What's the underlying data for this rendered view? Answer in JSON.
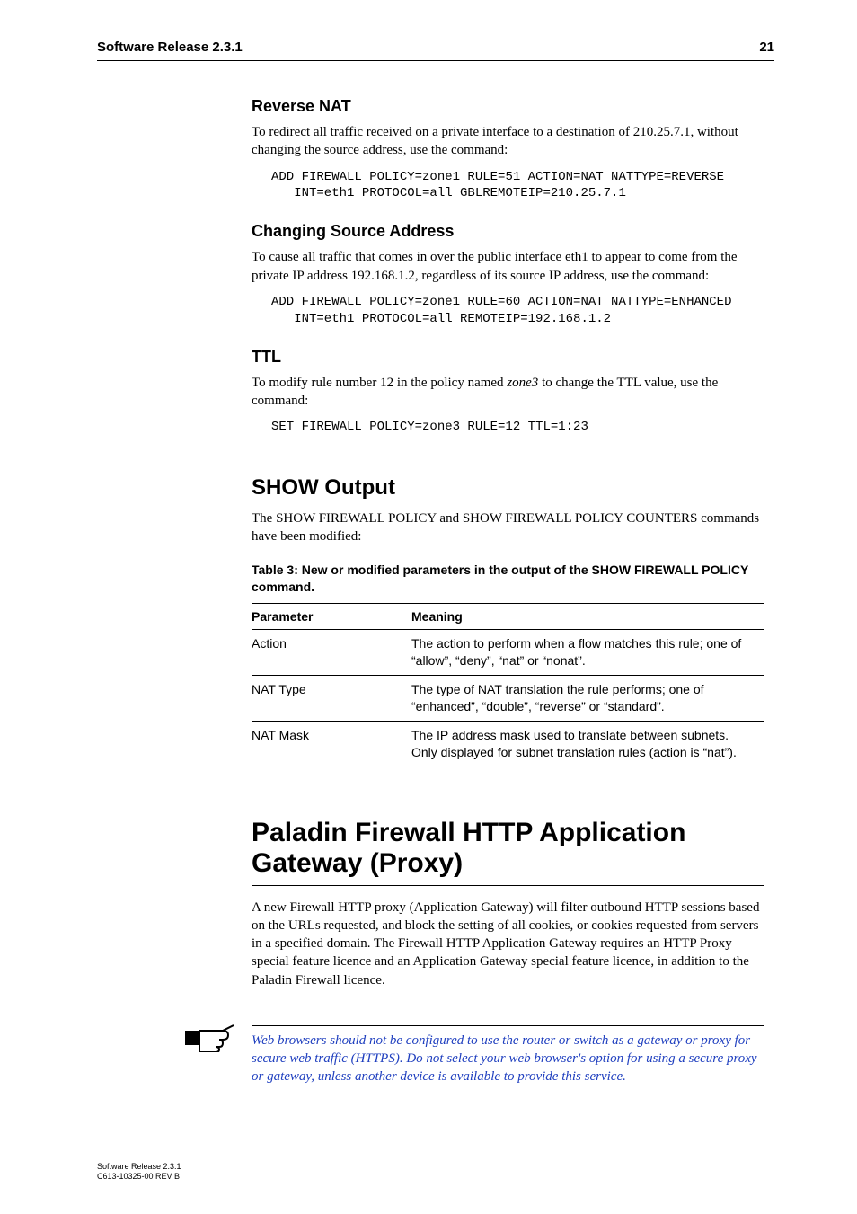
{
  "runhead": {
    "left": "Software Release 2.3.1",
    "right": "21"
  },
  "sec_reverse_nat": {
    "title": "Reverse NAT",
    "para": "To redirect all traffic received on a private interface to a destination of 210.25.7.1, without changing the source address, use the command:",
    "code": "ADD FIREWALL POLICY=zone1 RULE=51 ACTION=NAT NATTYPE=REVERSE\n   INT=eth1 PROTOCOL=all GBLREMOTEIP=210.25.7.1"
  },
  "sec_change_src": {
    "title": "Changing Source Address",
    "para": "To cause all traffic that comes in over the public interface eth1 to appear to come from the private IP address 192.168.1.2, regardless of its source IP address, use the command:",
    "code": "ADD FIREWALL POLICY=zone1 RULE=60 ACTION=NAT NATTYPE=ENHANCED\n   INT=eth1 PROTOCOL=all REMOTEIP=192.168.1.2"
  },
  "sec_ttl": {
    "title": "TTL",
    "para_pre": "To modify rule number 12 in the policy named ",
    "para_em": "zone3",
    "para_post": " to change the TTL value, use the command:",
    "code": "SET FIREWALL POLICY=zone3 RULE=12 TTL=1:23"
  },
  "sec_show": {
    "title": "SHOW Output",
    "para": "The SHOW FIREWALL POLICY and SHOW FIREWALL POLICY COUNTERS commands have been modified:",
    "table_caption": "Table 3: New or modified parameters in the output of the SHOW FIREWALL POLICY command.",
    "th_param": "Parameter",
    "th_meaning": "Meaning",
    "rows": [
      {
        "param": "Action",
        "meaning": "The action to perform when a flow matches this rule; one of “allow”, “deny”, “nat” or “nonat”."
      },
      {
        "param": "NAT Type",
        "meaning": "The type of NAT translation the rule performs; one of “enhanced”, “double”, “reverse” or “standard”."
      },
      {
        "param": "NAT Mask",
        "meaning": "The IP address mask used to translate between subnets. Only displayed for subnet translation rules (action is “nat”)."
      }
    ]
  },
  "sec_paladin": {
    "title_l1": "Paladin Firewall HTTP Application",
    "title_l2": "Gateway (Proxy)",
    "para": "A new Firewall HTTP proxy (Application Gateway) will filter outbound HTTP sessions based on the URLs requested, and block the setting of all cookies, or cookies requested from servers in a specified domain. The Firewall HTTP Application Gateway requires an HTTP Proxy special feature licence and an Application Gateway special feature licence, in addition to the Paladin Firewall licence."
  },
  "note": {
    "text": "Web browsers should not be configured to use the router or switch as a gateway or proxy for secure web traffic (HTTPS). Do not select your web browser's option for using a secure proxy or gateway, unless another device is available to provide this service."
  },
  "footer": {
    "l1": "Software Release 2.3.1",
    "l2": "C613-10325-00 REV B"
  }
}
